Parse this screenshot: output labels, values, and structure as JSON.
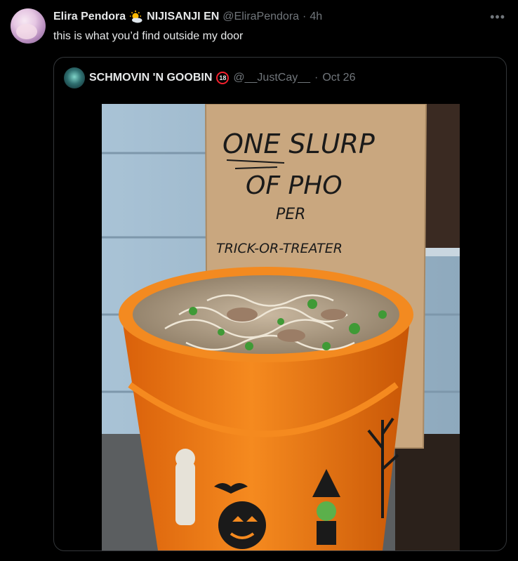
{
  "tweet": {
    "author_name": "Elira Pendora",
    "affiliation": "NIJISANJI EN",
    "handle": "@EliraPendora",
    "separator": "·",
    "time": "4h",
    "text": "this is what you’d find outside my door",
    "avatar_icon": "elira-avatar",
    "more_icon": "more-icon"
  },
  "quoted": {
    "author_name": "SCHMOVIN 'N GOOBIN",
    "badge": "18",
    "handle": "@__JustCay__",
    "separator": "·",
    "date": "Oct 26",
    "image": {
      "sign_lines": [
        "ONE SLURP",
        "OF PHO",
        "PER",
        "TRICK-OR-TREATER"
      ],
      "description_icon": "pho-bucket-photo"
    }
  },
  "colors": {
    "background": "#000000",
    "text_primary": "#e7e9ea",
    "text_secondary": "#71767b",
    "border": "#333639",
    "bucket_orange": "#f07a14",
    "badge_red": "#f4212e"
  }
}
